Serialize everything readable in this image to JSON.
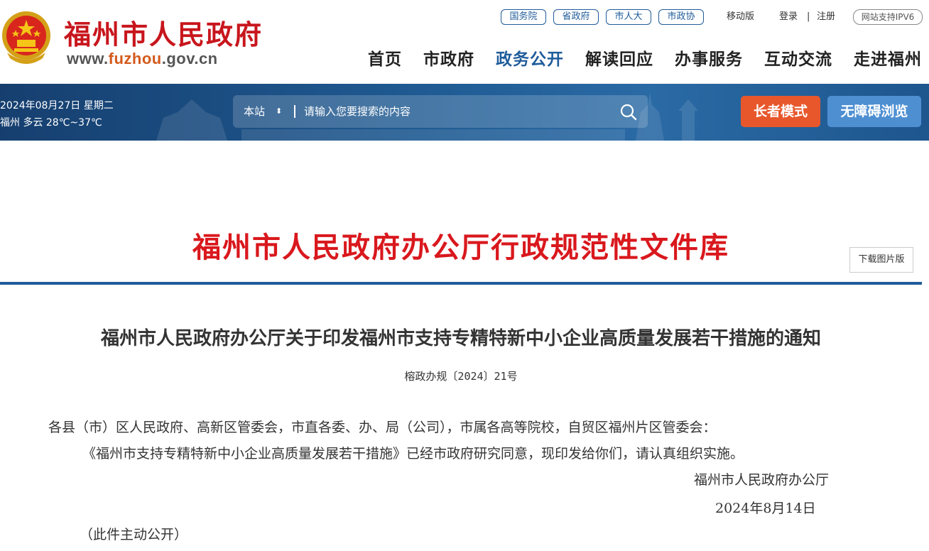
{
  "header": {
    "site_name": "福州市人民政府",
    "url_prefix": "www.",
    "url_highlight": "fuzhou",
    "url_suffix": ".gov.cn",
    "top_links": [
      "国务院",
      "省政府",
      "市人大",
      "市政协"
    ],
    "mobile": "移动版",
    "login": "登录",
    "separator": "|",
    "register": "注册",
    "ipv6": "网站支持IPV6",
    "nav": [
      "首页",
      "市政府",
      "政务公开",
      "解读回应",
      "办事服务",
      "互动交流",
      "走进福州"
    ],
    "active_nav": "政务公开"
  },
  "banner": {
    "date": "2024年08月27日 星期二",
    "weather": "福州 多云 28℃~37℃",
    "search_scope": "本站",
    "search_scope_arrow": "⬍",
    "search_placeholder": "请输入您要搜索的内容",
    "elder_mode": "长者模式",
    "accessible": "无障碍浏览"
  },
  "content": {
    "library_title": "福州市人民政府办公厅行政规范性文件库",
    "download_button": "下载图片版",
    "doc_title": "福州市人民政府办公厅关于印发福州市支持专精特新中小企业高质量发展若干措施的通知",
    "doc_number": "榕政办规〔2024〕21号",
    "recipients": "各县（市）区人民政府、高新区管委会，市直各委、办、局（公司），市属各高等院校，自贸区福州片区管委会：",
    "body": "《福州市支持专精特新中小企业高质量发展若干措施》已经市政府研究同意，现印发给你们，请认真组织实施。",
    "signer": "福州市人民政府办公厅",
    "sign_date": "2024年8月14日",
    "disclosure": "（此件主动公开）"
  },
  "colors": {
    "brand_red": "#c8161d",
    "nav_blue": "#1f5c9a",
    "elder_orange": "#e8572b",
    "access_blue": "#4e8fd2"
  }
}
